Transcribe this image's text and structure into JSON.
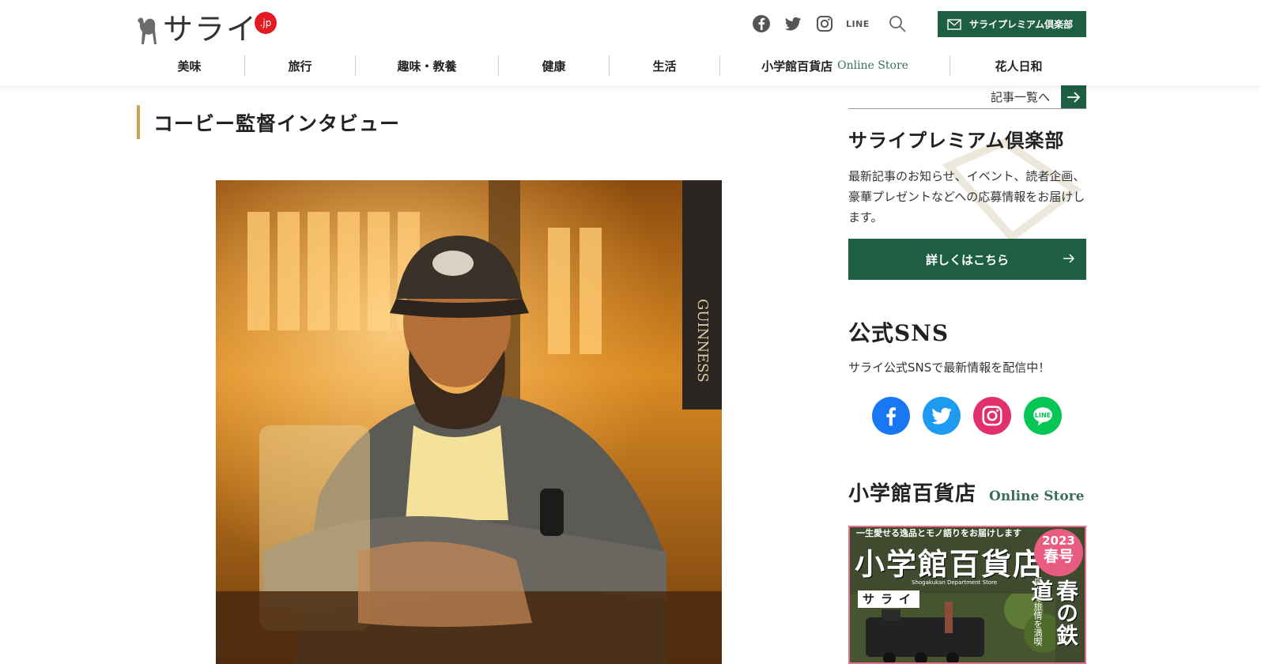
{
  "header": {
    "logo_text": "サライ",
    "logo_badge": ".jp",
    "social": [
      "facebook-icon",
      "twitter-icon",
      "instagram-icon"
    ],
    "line_label": "LINE",
    "premium_label": "サライプレミアム倶楽部"
  },
  "nav": {
    "items": [
      {
        "label": "美味"
      },
      {
        "label": "旅行"
      },
      {
        "label": "趣味・教養"
      },
      {
        "label": "健康"
      },
      {
        "label": "生活"
      },
      {
        "label": "小学館百貨店",
        "sub": "Online Store"
      },
      {
        "label": "花人日和"
      }
    ]
  },
  "main": {
    "title": "コービー監督インタビュー"
  },
  "sidebar": {
    "more_label": "記事一覧へ",
    "club": {
      "heading": "サライプレミアム倶楽部",
      "text": "最新記事のお知らせ、イベント、読者企画、豪華プレゼントなどへの応募情報をお届けします。",
      "button": "詳しくはこちら"
    },
    "sns": {
      "heading": "公式SNS",
      "text": "サライ公式SNSで最新情報を配信中！",
      "colors": {
        "facebook": "#1877f2",
        "twitter": "#1d9bf0",
        "instagram": "#e1306c",
        "line": "#06c755"
      }
    },
    "store": {
      "heading": "小学館百貨店",
      "sub": "Online Store",
      "magazine": {
        "top": "一生愛せる逸品とモノ語りをお届けします",
        "title": "小学館百貨店",
        "en": "Shogakukan Department Store",
        "logo": "サライ",
        "year": "2023",
        "season": "春号",
        "side_small": "卓上で旅情を満喫",
        "side": "春の鉄道"
      }
    }
  },
  "colors": {
    "brand_green": "#1e5e44",
    "accent_gold": "#c9a64e",
    "badge_red": "#e21b23"
  }
}
